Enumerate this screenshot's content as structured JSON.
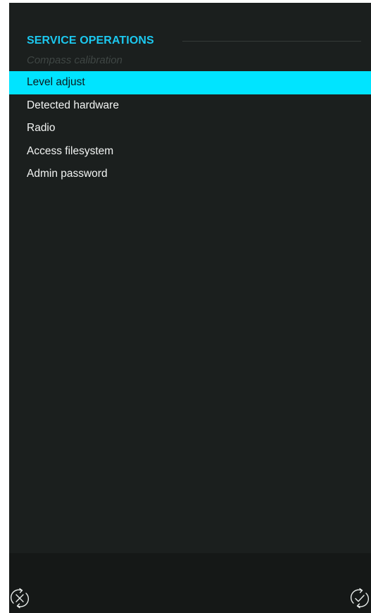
{
  "header": {
    "title": "SERVICE OPERATIONS",
    "subtitle": "Compass calibration"
  },
  "menu": {
    "selected_index": 0,
    "items": [
      {
        "label": "Level adjust"
      },
      {
        "label": "Detected hardware"
      },
      {
        "label": "Radio"
      },
      {
        "label": "Access filesystem"
      },
      {
        "label": "Admin password"
      }
    ]
  },
  "bottom_bar": {
    "left_icon": "cancel-sync-icon",
    "right_icon": "confirm-sync-icon"
  },
  "colors": {
    "background": "#1b1f1e",
    "accent": "#1cc8ef",
    "selection": "#00e4ff",
    "bottom_bar": "#151817",
    "text": "#f2f4f3",
    "disabled_text": "#3f4644"
  }
}
